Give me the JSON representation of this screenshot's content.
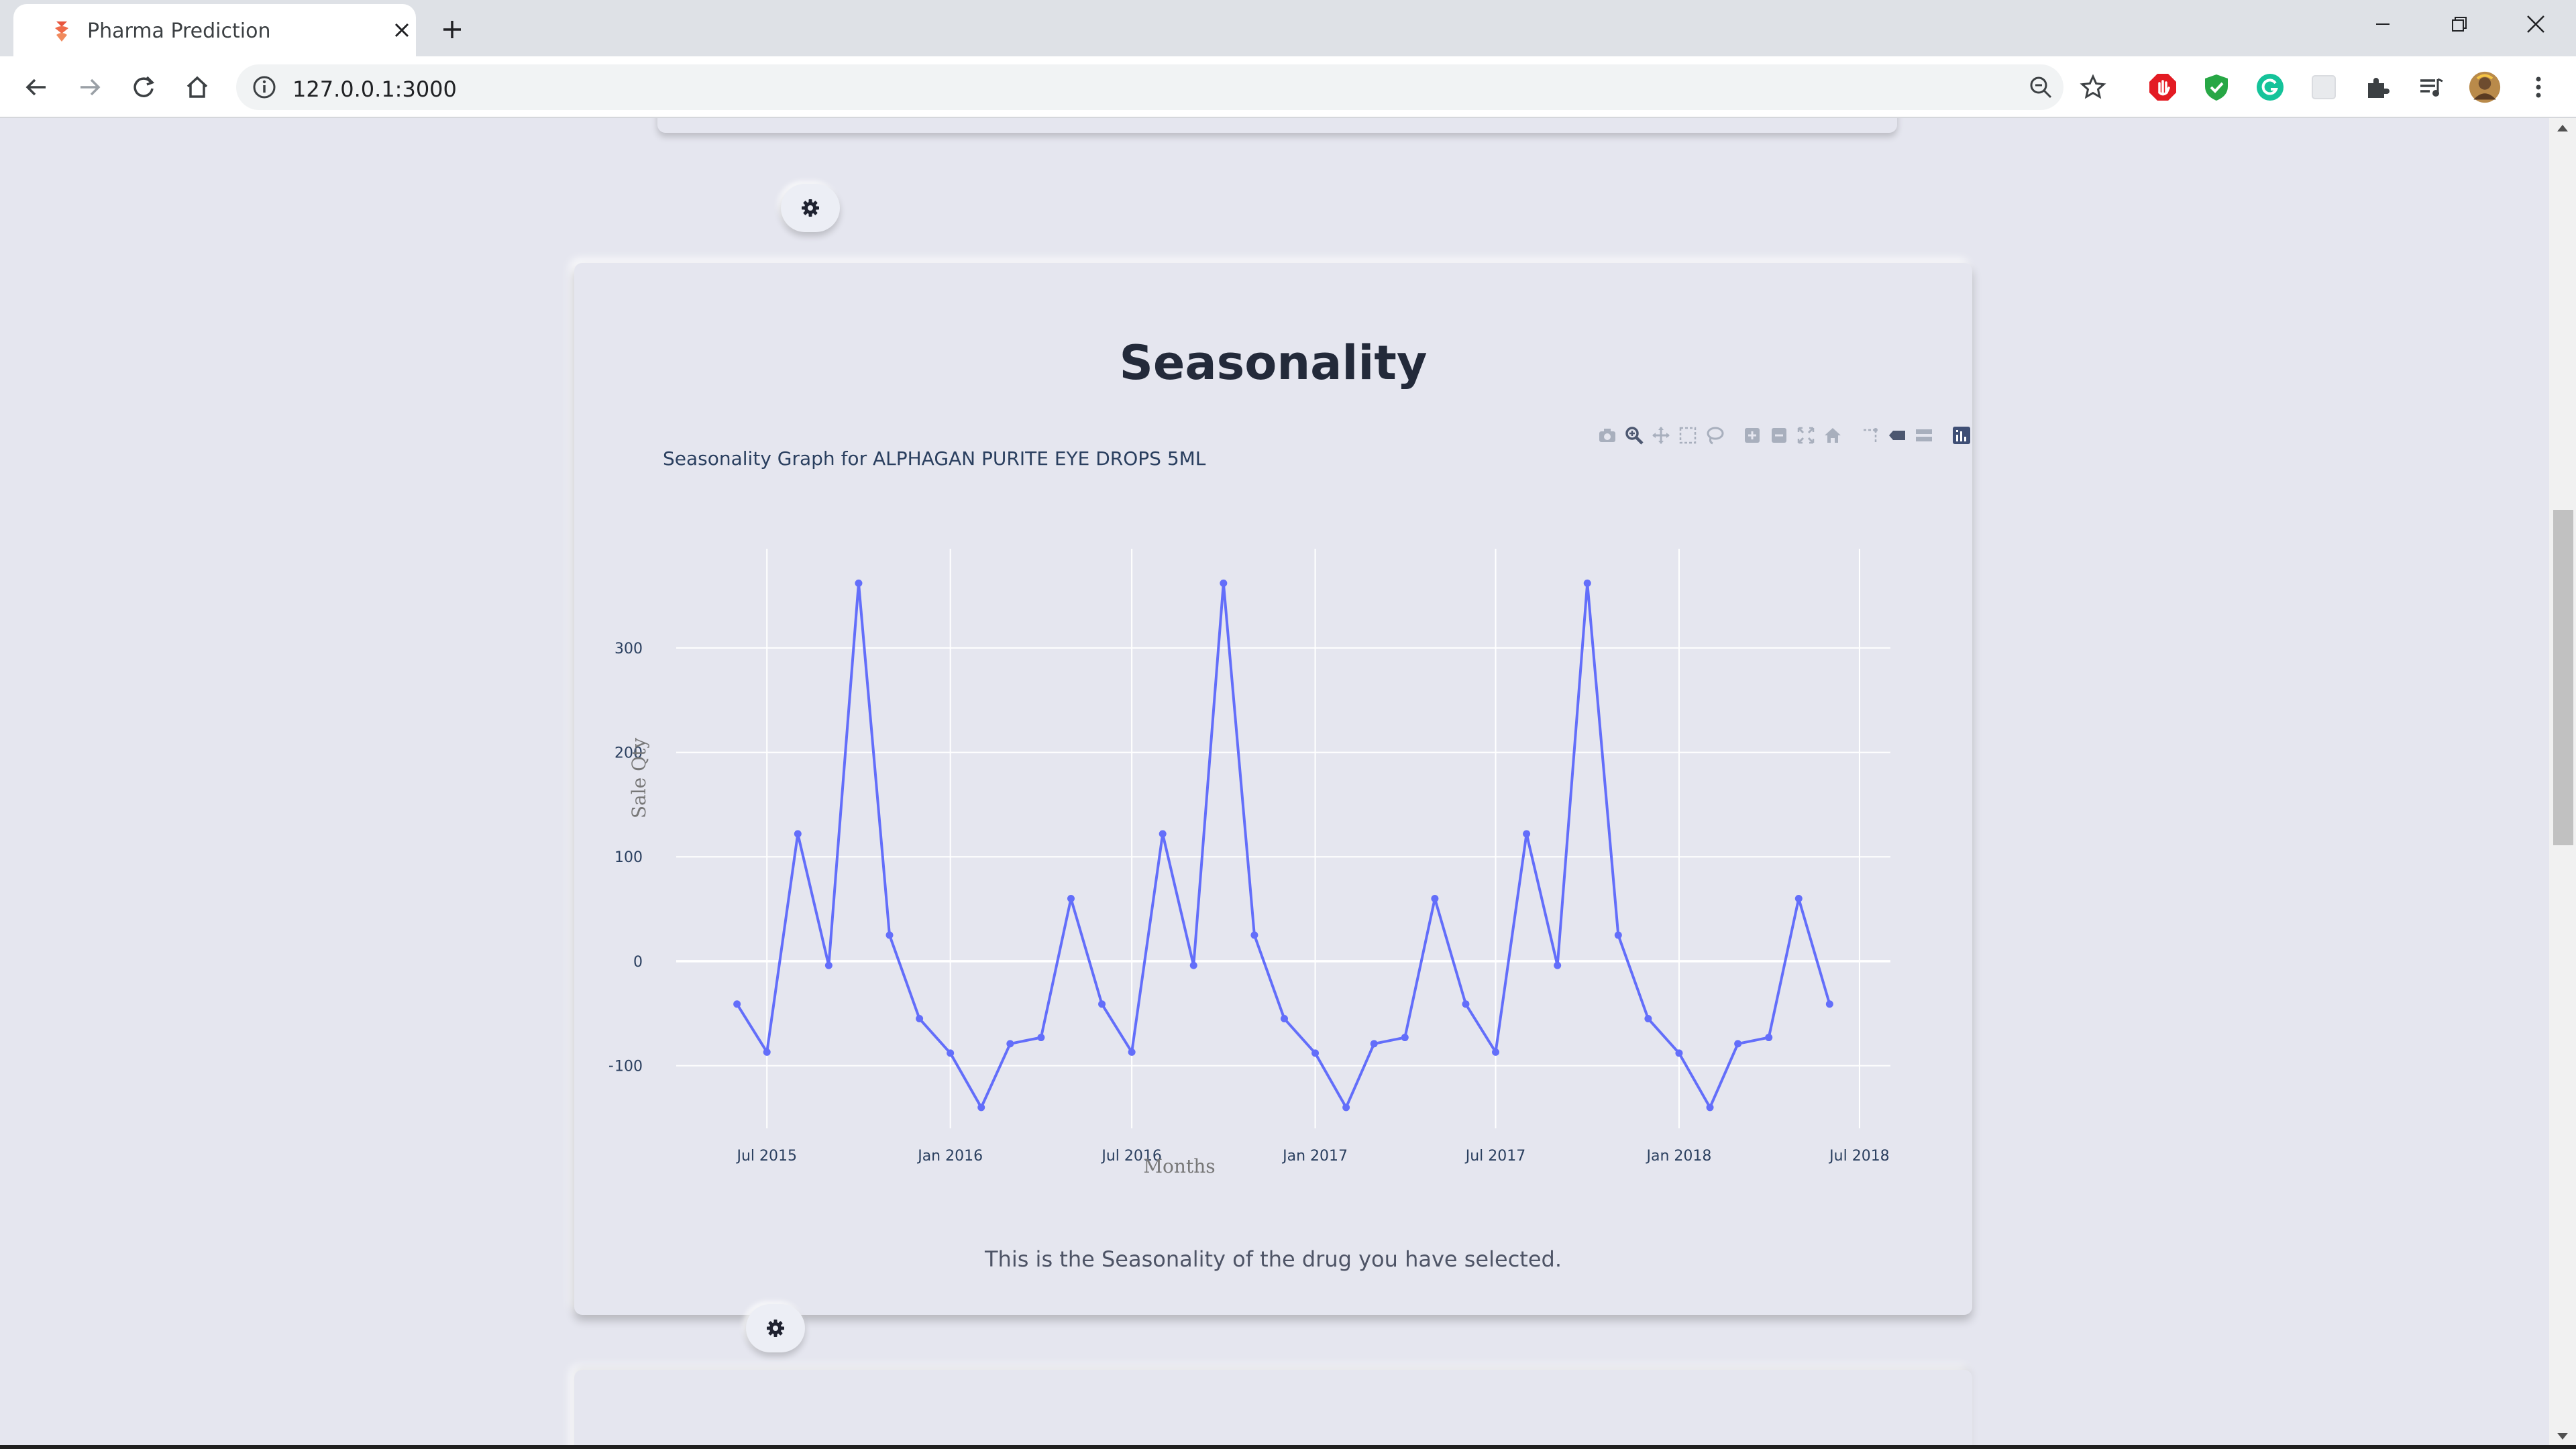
{
  "browser": {
    "tab_title": "Pharma Prediction",
    "url": "127.0.0.1:3000"
  },
  "card": {
    "title": "Seasonality",
    "caption": "This is the Seasonality of the drug you have selected."
  },
  "chart_data": {
    "type": "line",
    "title": "Seasonality Graph for ALPHAGAN PURITE EYE DROPS 5ML",
    "xlabel": "Months",
    "ylabel": "Sale Qty",
    "x_ticks": [
      "Jul 2015",
      "Jan 2016",
      "Jul 2016",
      "Jan 2017",
      "Jul 2017",
      "Jan 2018",
      "Jul 2018"
    ],
    "y_ticks": [
      "−100",
      "0",
      "100",
      "200",
      "300"
    ],
    "y_tick_values": [
      -100,
      0,
      100,
      200,
      300
    ],
    "ylim": [
      -160,
      395
    ],
    "xlim": [
      "2015-04-01",
      "2018-08-01"
    ],
    "x": [
      "2015-06-01",
      "2015-07-01",
      "2015-08-01",
      "2015-09-01",
      "2015-10-01",
      "2015-11-01",
      "2015-12-01",
      "2016-01-01",
      "2016-02-01",
      "2016-03-01",
      "2016-04-01",
      "2016-05-01",
      "2016-06-01",
      "2016-07-01",
      "2016-08-01",
      "2016-09-01",
      "2016-10-01",
      "2016-11-01",
      "2016-12-01",
      "2017-01-01",
      "2017-02-01",
      "2017-03-01",
      "2017-04-01",
      "2017-05-01",
      "2017-06-01",
      "2017-07-01",
      "2017-08-01",
      "2017-09-01",
      "2017-10-01",
      "2017-11-01",
      "2017-12-01",
      "2018-01-01",
      "2018-02-01",
      "2018-03-01",
      "2018-04-01",
      "2018-05-01",
      "2018-06-01"
    ],
    "series": [
      {
        "color": "#636efa",
        "values": [
          -41,
          -87,
          122,
          -4,
          362,
          25,
          -55,
          -88,
          -140,
          -79,
          -73,
          60,
          -41,
          -87,
          122,
          -4,
          362,
          25,
          -55,
          -88,
          -140,
          -79,
          -73,
          60,
          -41,
          -87,
          122,
          -4,
          362,
          25,
          -55,
          -88,
          -140,
          -79,
          -73,
          60,
          -41
        ]
      }
    ],
    "grid": true,
    "background": "#e5e6ef"
  },
  "icons": {
    "gear": "gear-icon",
    "modebar": [
      "camera-icon",
      "zoom-icon",
      "pan-icon",
      "box-select-icon",
      "lasso-icon",
      "zoom-in-icon",
      "zoom-out-icon",
      "autoscale-icon",
      "reset-axes-icon",
      "spike-lines-icon",
      "hover-closest-icon",
      "hover-compare-icon",
      "plotly-logo-icon"
    ]
  }
}
